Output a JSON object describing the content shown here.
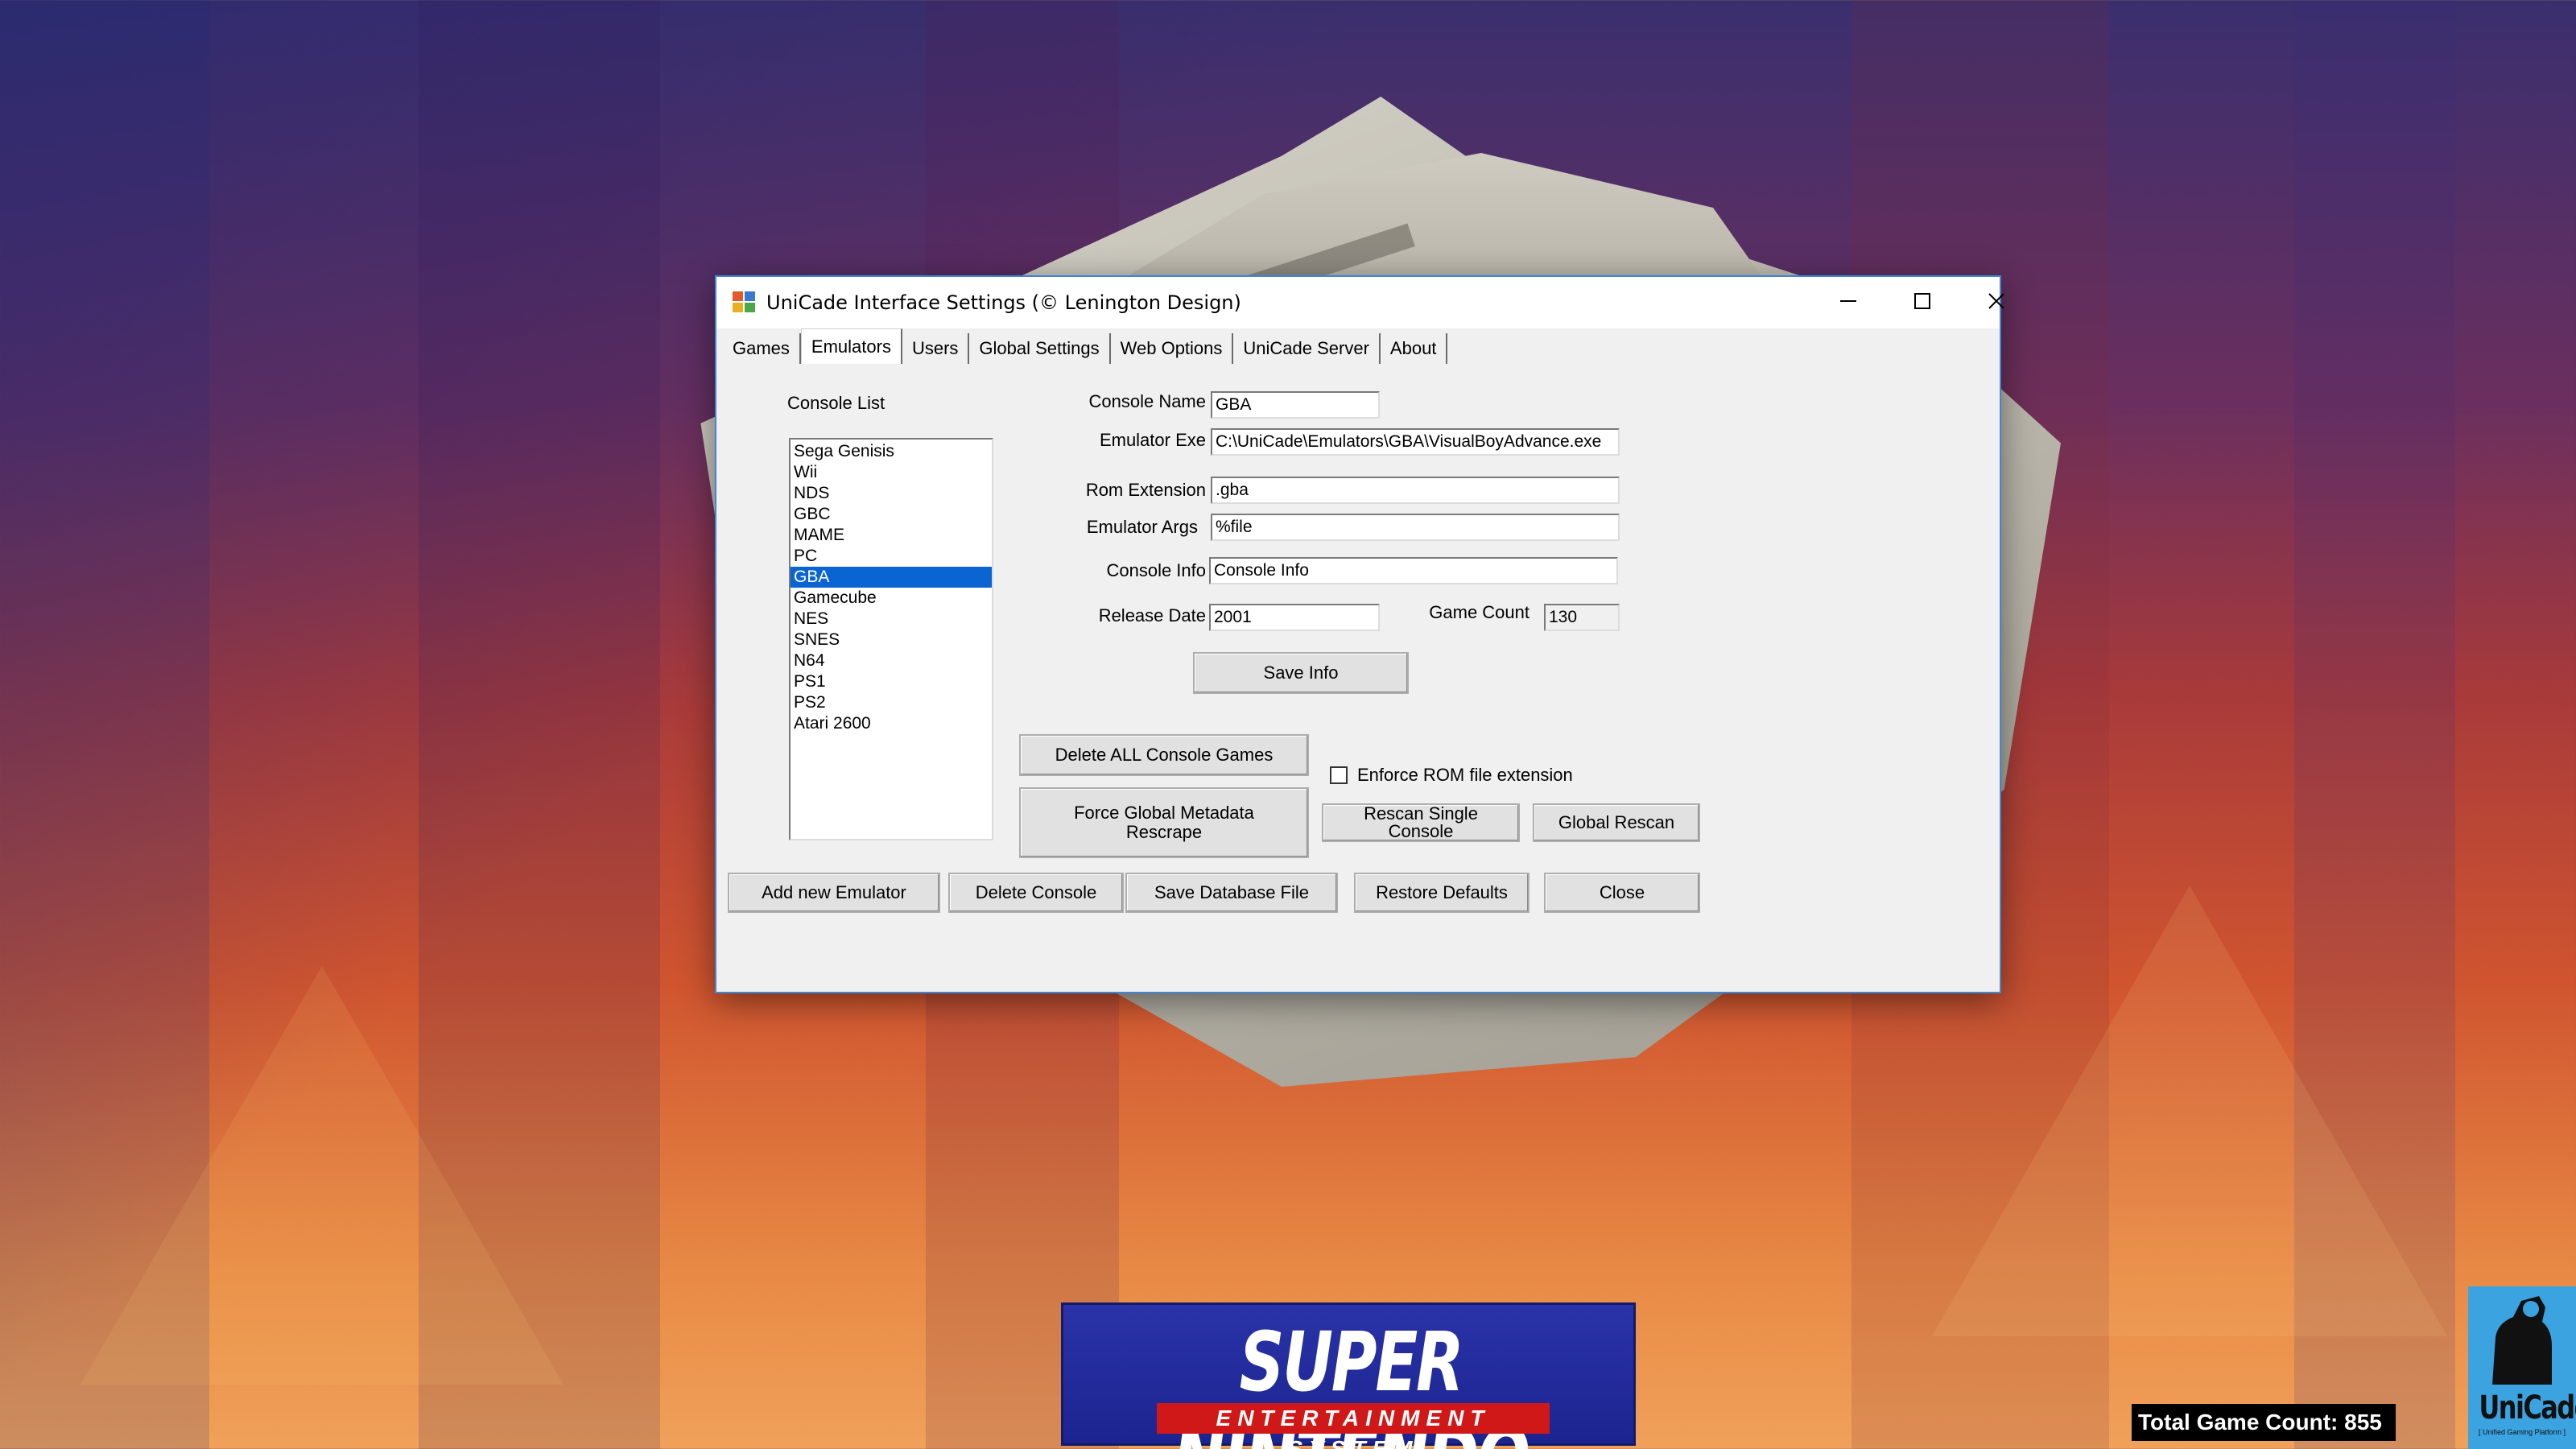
{
  "window": {
    "title": "UniCade Interface Settings (© Lenington Design)",
    "tabs": [
      "Games",
      "Emulators",
      "Users",
      "Global Settings",
      "Web Options",
      "UniCade Server",
      "About"
    ],
    "active_tab": "Emulators"
  },
  "console_list": {
    "label": "Console List",
    "items": [
      "Sega Genisis",
      "Wii",
      "NDS",
      "GBC",
      "MAME",
      "PC",
      "GBA",
      "Gamecube",
      "NES",
      "SNES",
      "N64",
      "PS1",
      "PS2",
      "Atari 2600"
    ],
    "selected": "GBA"
  },
  "form": {
    "console_name_label": "Console Name",
    "console_name": "GBA",
    "emulator_exe_label": "Emulator Exe",
    "emulator_exe": "C:\\UniCade\\Emulators\\GBA\\VisualBoyAdvance.exe",
    "rom_extension_label": "Rom Extension",
    "rom_extension": ".gba",
    "emulator_args_label": "Emulator Args",
    "emulator_args": "%file",
    "console_info_label": "Console Info",
    "console_info": "Console Info",
    "release_date_label": "Release Date",
    "release_date": "2001",
    "game_count_label": "Game Count",
    "game_count": "130"
  },
  "buttons": {
    "save_info": "Save Info",
    "delete_all_console_games": "Delete ALL Console Games",
    "force_global_metadata_rescrape": "Force Global Metadata Rescrape",
    "rescan_single_console": "Rescan Single Console",
    "global_rescan": "Global Rescan",
    "add_new_emulator": "Add new Emulator",
    "delete_console": "Delete Console",
    "save_database_file": "Save Database File",
    "restore_defaults": "Restore Defaults",
    "close": "Close"
  },
  "checkbox": {
    "enforce_rom_label": "Enforce ROM file extension",
    "enforce_rom_checked": false
  },
  "overlay": {
    "snes_title": "SUPER NINTENDO",
    "snes_subtitle": "ENTERTAINMENT SYSTEM",
    "total_game_count": "Total Game Count: 855",
    "logo_text": "UniCade",
    "logo_subtext": "[ Unified Gaming Platform ]"
  },
  "colors": {
    "selection": "#0a64d2",
    "window_border": "#3f86d6",
    "snes_blue": "#2a33a8",
    "snes_red": "#d01818",
    "logo_blue": "#3aa3e0"
  }
}
